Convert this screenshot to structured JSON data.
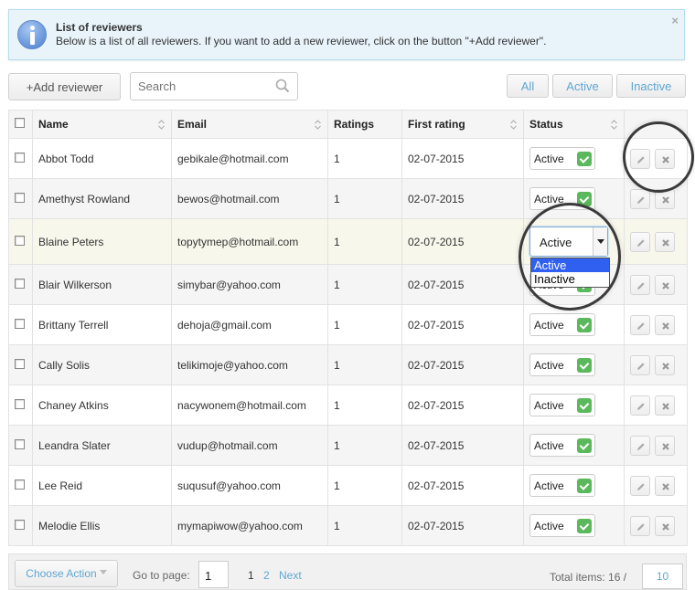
{
  "info": {
    "title": "List of reviewers",
    "text": "Below is a list of all reviewers. If you want to add a new reviewer, click on the button \"+Add reviewer\".",
    "close": "×"
  },
  "toolbar": {
    "add_label": "+Add reviewer",
    "search_placeholder": "Search",
    "filters": [
      "All",
      "Active",
      "Inactive"
    ]
  },
  "table": {
    "columns": [
      "Name",
      "Email",
      "Ratings",
      "First rating",
      "Status"
    ],
    "rows": [
      {
        "name": "Abbot Todd",
        "email": "gebikale@hotmail.com",
        "ratings": "1",
        "first_rating": "02-07-2015",
        "status": "Active"
      },
      {
        "name": "Amethyst Rowland",
        "email": "bewos@hotmail.com",
        "ratings": "1",
        "first_rating": "02-07-2015",
        "status": "Active"
      },
      {
        "name": "Blaine Peters",
        "email": "topytymep@hotmail.com",
        "ratings": "1",
        "first_rating": "02-07-2015",
        "status": "Active"
      },
      {
        "name": "Blair Wilkerson",
        "email": "simybar@yahoo.com",
        "ratings": "1",
        "first_rating": "02-07-2015",
        "status": "Active"
      },
      {
        "name": "Brittany Terrell",
        "email": "dehoja@gmail.com",
        "ratings": "1",
        "first_rating": "02-07-2015",
        "status": "Active"
      },
      {
        "name": "Cally Solis",
        "email": "telikimoje@yahoo.com",
        "ratings": "1",
        "first_rating": "02-07-2015",
        "status": "Active"
      },
      {
        "name": "Chaney Atkins",
        "email": "nacywonem@hotmail.com",
        "ratings": "1",
        "first_rating": "02-07-2015",
        "status": "Active"
      },
      {
        "name": "Leandra Slater",
        "email": "vudup@hotmail.com",
        "ratings": "1",
        "first_rating": "02-07-2015",
        "status": "Active"
      },
      {
        "name": "Lee Reid",
        "email": "suqusuf@yahoo.com",
        "ratings": "1",
        "first_rating": "02-07-2015",
        "status": "Active"
      },
      {
        "name": "Melodie Ellis",
        "email": "mymapiwow@yahoo.com",
        "ratings": "1",
        "first_rating": "02-07-2015",
        "status": "Active"
      }
    ]
  },
  "status_dropdown": {
    "value": "Active",
    "options": [
      "Active",
      "Inactive"
    ],
    "selected": "Active"
  },
  "footer": {
    "choose_action": "Choose Action",
    "goto_label": "Go to page:",
    "goto_value": "1",
    "current_page": "1",
    "page_links": [
      "2",
      "Next"
    ],
    "total_label": "Total items: 16 /",
    "per_page": "10"
  },
  "colors": {
    "accent": "#5fa7d0",
    "status_ok": "#5cb85c",
    "dropdown_selected": "#3060f0",
    "info_bg": "#e8f4fa",
    "highlight_row": "#f8f7ec"
  }
}
